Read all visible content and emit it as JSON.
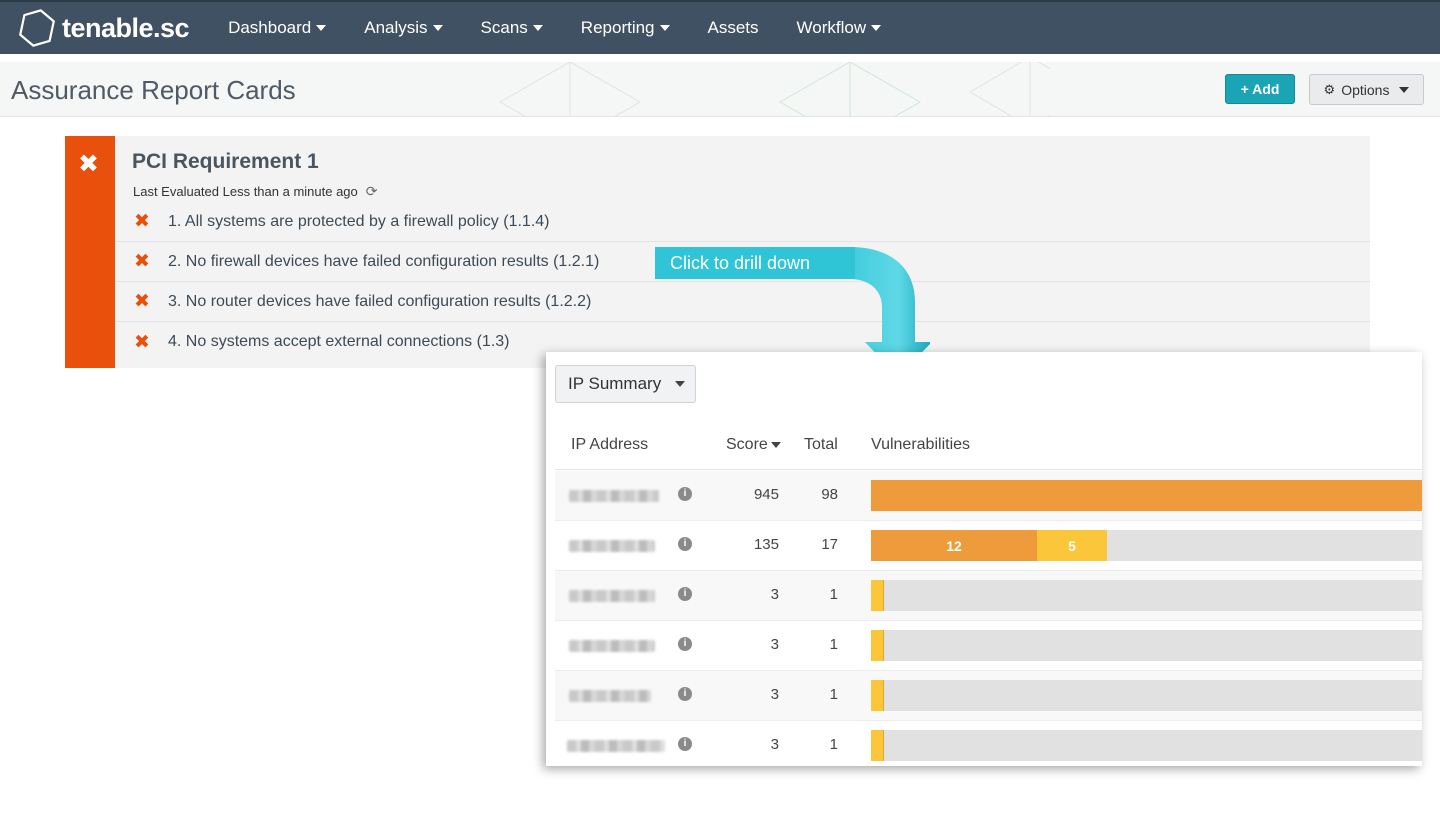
{
  "app": {
    "logo_text": "tenable.sc",
    "nav": [
      {
        "label": "Dashboard",
        "dropdown": true
      },
      {
        "label": "Analysis",
        "dropdown": true
      },
      {
        "label": "Scans",
        "dropdown": true
      },
      {
        "label": "Reporting",
        "dropdown": true
      },
      {
        "label": "Assets",
        "dropdown": false
      },
      {
        "label": "Workflow",
        "dropdown": true
      }
    ]
  },
  "header": {
    "title": "Assurance Report Cards",
    "add_label": "+ Add",
    "options_label": "Options"
  },
  "card": {
    "status": "fail",
    "status_color": "#e8500b",
    "title": "PCI Requirement 1",
    "last_evaluated": "Last Evaluated Less than a minute ago",
    "requirements": [
      {
        "text": "1. All systems are protected by a firewall policy (1.1.4)",
        "status": "fail"
      },
      {
        "text": "2. No firewall devices have failed configuration results (1.2.1)",
        "status": "fail"
      },
      {
        "text": "3. No router devices have failed configuration results (1.2.2)",
        "status": "fail"
      },
      {
        "text": "4. No systems accept external connections (1.3)",
        "status": "fail"
      }
    ]
  },
  "callout": {
    "text": "Click to drill down",
    "color": "#2fc4d6"
  },
  "drilldown": {
    "tool_label": "IP Summary",
    "columns": {
      "ip": "IP Address",
      "score": "Score",
      "total": "Total",
      "vulns": "Vulnerabilities"
    },
    "sort_column": "score",
    "severity_colors": {
      "high": "#ee9b3b",
      "medium": "#fcc63a",
      "empty": "#e1e1e1"
    },
    "rows": [
      {
        "score": "945",
        "total": "98",
        "high": 98,
        "medium": 0,
        "high_label": "",
        "medium_label": ""
      },
      {
        "score": "135",
        "total": "17",
        "high": 12,
        "medium": 5,
        "high_label": "12",
        "medium_label": "5"
      },
      {
        "score": "3",
        "total": "1",
        "high": 0,
        "medium": 1,
        "high_label": "",
        "medium_label": ""
      },
      {
        "score": "3",
        "total": "1",
        "high": 0,
        "medium": 1,
        "high_label": "",
        "medium_label": ""
      },
      {
        "score": "3",
        "total": "1",
        "high": 0,
        "medium": 1,
        "high_label": "",
        "medium_label": ""
      },
      {
        "score": "3",
        "total": "1",
        "high": 0,
        "medium": 1,
        "high_label": "",
        "medium_label": ""
      }
    ]
  }
}
